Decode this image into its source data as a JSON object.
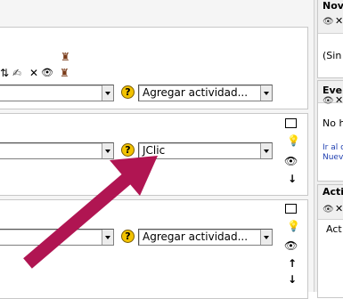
{
  "topics": [
    {
      "select_value": "Agregar actividad..."
    },
    {
      "select_value": "JClic"
    },
    {
      "select_value": "Agregar actividad..."
    }
  ],
  "help_symbol": "?",
  "sidebar": {
    "blocks": [
      {
        "title": "Nov",
        "lines": [
          "(Sin"
        ]
      },
      {
        "title": "Eve",
        "lines": [
          "No h"
        ],
        "links": [
          "Ir al c",
          "Nuev"
        ]
      },
      {
        "title": "Acti",
        "lines": [
          "Act"
        ]
      }
    ]
  },
  "icons": {
    "person": "person-icon",
    "move_updown": "move-up-down-icon",
    "edit": "edit-icon",
    "delete": "delete-icon",
    "eye": "eye-icon",
    "box": "show-only-topic-icon",
    "bulb": "highlight-icon",
    "down": "move-down-icon",
    "up": "move-up-icon"
  },
  "colors": {
    "arrow": "#b01552",
    "help": "#f2c200",
    "link": "#1f3fb0"
  }
}
